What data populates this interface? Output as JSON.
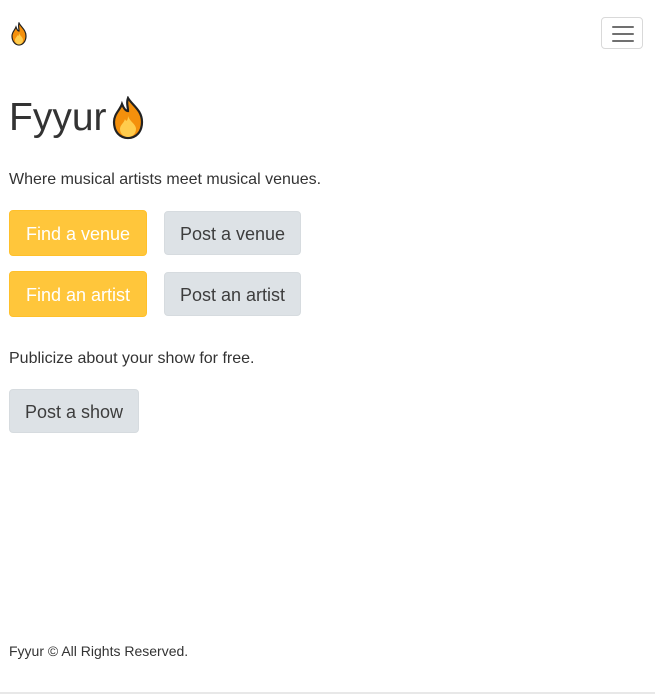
{
  "navbar": {
    "brand_icon": "fire-icon",
    "menu_icon": "hamburger-menu-icon"
  },
  "hero": {
    "title": "Fyyur",
    "title_icon": "fire-icon",
    "tagline": "Where musical artists meet musical venues."
  },
  "actions": {
    "find_venue": "Find a venue",
    "post_venue": "Post a venue",
    "find_artist": "Find an artist",
    "post_artist": "Post an artist"
  },
  "shows": {
    "text": "Publicize about your show for free.",
    "post_show": "Post a show"
  },
  "footer": {
    "text": "Fyyur © All Rights Reserved."
  },
  "colors": {
    "warning": "#ffc63b",
    "default": "#dde2e6",
    "text": "#333333"
  }
}
